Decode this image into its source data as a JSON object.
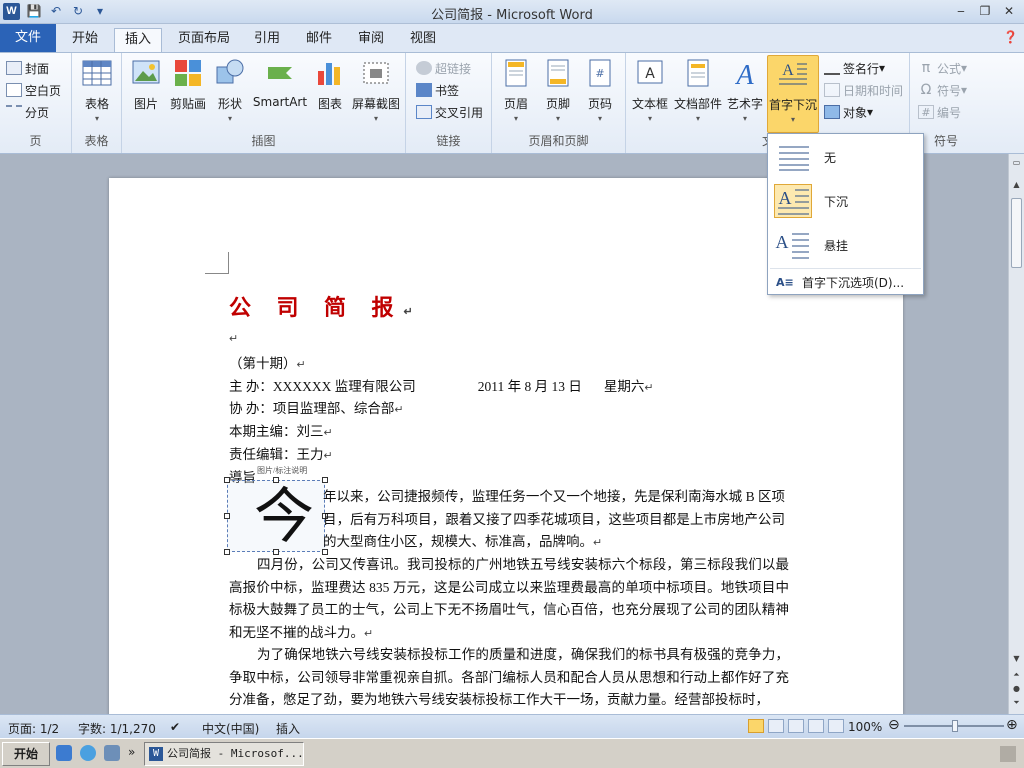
{
  "window": {
    "title": "公司简报 - Microsoft Word",
    "app_icon": "W"
  },
  "tabs": [
    {
      "label": "文件"
    },
    {
      "label": "开始"
    },
    {
      "label": "插入"
    },
    {
      "label": "页面布局"
    },
    {
      "label": "引用"
    },
    {
      "label": "邮件"
    },
    {
      "label": "审阅"
    },
    {
      "label": "视图"
    }
  ],
  "ribbon": {
    "pages": {
      "label": "页",
      "items": [
        "封面",
        "空白页",
        "分页"
      ]
    },
    "tables": {
      "label": "表格",
      "button": "表格"
    },
    "illustrations": {
      "label": "插图",
      "buttons": [
        "图片",
        "剪贴画",
        "形状",
        "SmartArt",
        "图表",
        "屏幕截图"
      ]
    },
    "links": {
      "label": "链接",
      "items": [
        "超链接",
        "书签",
        "交叉引用"
      ]
    },
    "header_footer": {
      "label": "页眉和页脚",
      "buttons": [
        "页眉",
        "页脚",
        "页码"
      ]
    },
    "text": {
      "label": "文",
      "buttons": [
        "文本框",
        "文档部件",
        "艺术字",
        "首字下沉"
      ],
      "side_items": [
        "签名行",
        "日期和时间",
        "对象"
      ]
    },
    "symbols": {
      "label": "符号",
      "items": [
        "公式",
        "符号",
        "编号"
      ]
    }
  },
  "dropcap_menu": {
    "options": [
      {
        "label": "无"
      },
      {
        "label": "下沉"
      },
      {
        "label": "悬挂"
      }
    ],
    "more_label": "首字下沉选项(D)..."
  },
  "document": {
    "title": "公 司 简 报",
    "issue": "（第十期）",
    "host_label": "主    办：XXXXXX 监理有限公司",
    "date": "2011 年 8 月 13 日",
    "weekday": "星期六",
    "cohost": "协    办：项目监理部、综合部",
    "editor_in_chief": "本期主编：刘三",
    "responsible_editor": "责任编辑：王力",
    "lead_label": "導旨",
    "dropcap_char": "今",
    "dropcap_hint": "图片/标注说明",
    "paragraphs": [
      "年以来，公司捷报频传，监理任务一个又一个地接，先是保利南海水城 B 区项目，后有万科项目，跟着又接了四季花城项目，这些项目都是上市房地产公司的大型商住小区，规模大、标准高，品牌响。",
      "四月份，公司又传喜讯。我司投标的广州地铁五号线安装标六个标段，第三标段我们以最高报价中标，监理费达 835 万元，这是公司成立以来监理费最高的单项中标项目。地铁项目中标极大鼓舞了员工的士气，公司上下无不扬眉吐气，信心百倍，也充分展现了公司的团队精神和无坚不摧的战斗力。",
      "为了确保地铁六号线安装标投标工作的质量和进度，确保我们的标书具有极强的竞争力，争取中标，公司领导非常重视亲自抓。各部门编标人员和配合人员从思想和行动上都作好了充分准备，憋足了劲，要为地铁六号线安装标投标工作大干一场，贡献力量。经营部投标时，"
    ]
  },
  "statusbar": {
    "page": "页面: 1/2",
    "words": "字数: 1/1,270",
    "language": "中文(中国)",
    "mode": "插入",
    "zoom": "100%"
  },
  "taskbar": {
    "start": "开始",
    "task": "公司简报 - Microsof..."
  },
  "colors": {
    "accent": "#2b63b7",
    "title_red": "#c00000",
    "active_button": "#fbd66a"
  }
}
